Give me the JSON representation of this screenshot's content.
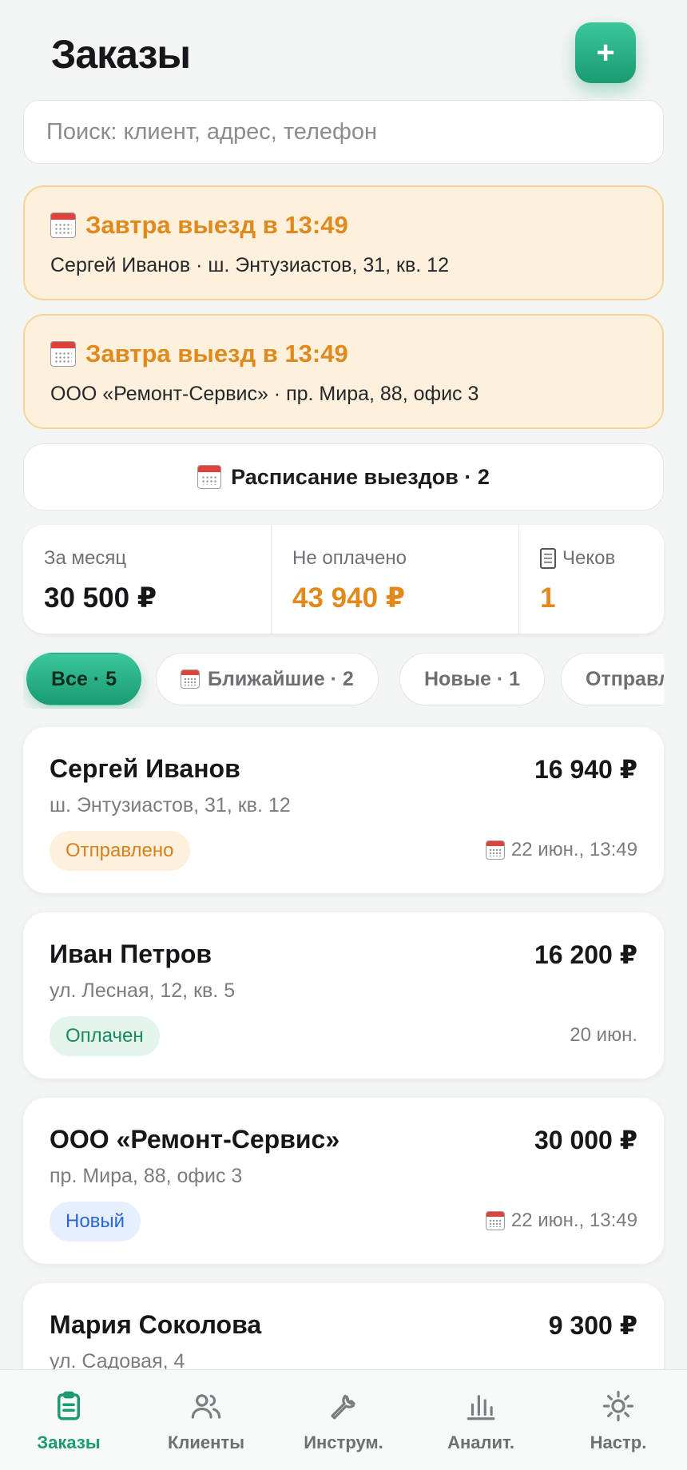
{
  "header": {
    "title": "Заказы",
    "add_label": "+"
  },
  "search": {
    "placeholder": "Поиск: клиент, адрес, телефон",
    "value": ""
  },
  "reminders": [
    {
      "title": "Завтра выезд в 13:49",
      "subtitle": "Сергей Иванов · ш. Энтузиастов, 31, кв. 12"
    },
    {
      "title": "Завтра выезд в 13:49",
      "subtitle": "ООО «Ремонт-Сервис» · пр. Мира, 88, офис 3"
    }
  ],
  "schedule": {
    "label": "Расписание выездов · 2"
  },
  "stats": {
    "month": {
      "label": "За месяц",
      "value": "30 500 ₽"
    },
    "unpaid": {
      "label": "Не оплачено",
      "value": "43 940 ₽"
    },
    "receipts": {
      "label": "Чеков",
      "value": "1"
    }
  },
  "filters": [
    {
      "label": "Все · 5",
      "active": true
    },
    {
      "label": "Ближайшие · 2",
      "active": false
    },
    {
      "label": "Новые · 1",
      "active": false
    },
    {
      "label": "Отправлено",
      "active": false
    }
  ],
  "orders": [
    {
      "name": "Сергей Иванов",
      "price": "16 940 ₽",
      "address": "ш. Энтузиастов, 31, кв. 12",
      "status": "Отправлено",
      "date": "22 июн., 13:49"
    },
    {
      "name": "Иван Петров",
      "price": "16 200 ₽",
      "address": "ул. Лесная, 12, кв. 5",
      "status": "Оплачен",
      "date": "20 июн."
    },
    {
      "name": "ООО «Ремонт-Сервис»",
      "price": "30 000 ₽",
      "address": "пр. Мира, 88, офис 3",
      "status": "Новый",
      "date": "22 июн., 13:49"
    },
    {
      "name": "Мария Соколова",
      "price": "9 300 ₽",
      "address": "ул. Садовая, 4"
    }
  ],
  "nav": [
    {
      "label": "Заказы",
      "icon": "orders-icon",
      "active": true
    },
    {
      "label": "Клиенты",
      "icon": "clients-icon"
    },
    {
      "label": "Инструм.",
      "icon": "wrench-icon"
    },
    {
      "label": "Аналит.",
      "icon": "chart-icon"
    },
    {
      "label": "Настр.",
      "icon": "settings-icon"
    }
  ],
  "colors": {
    "accent": "#1a9b72",
    "warning": "#e08a1e",
    "reminder_bg": "#fdf0dc",
    "status_sent": "#d8811b",
    "status_paid": "#178a5e",
    "status_new": "#2a66d8"
  }
}
